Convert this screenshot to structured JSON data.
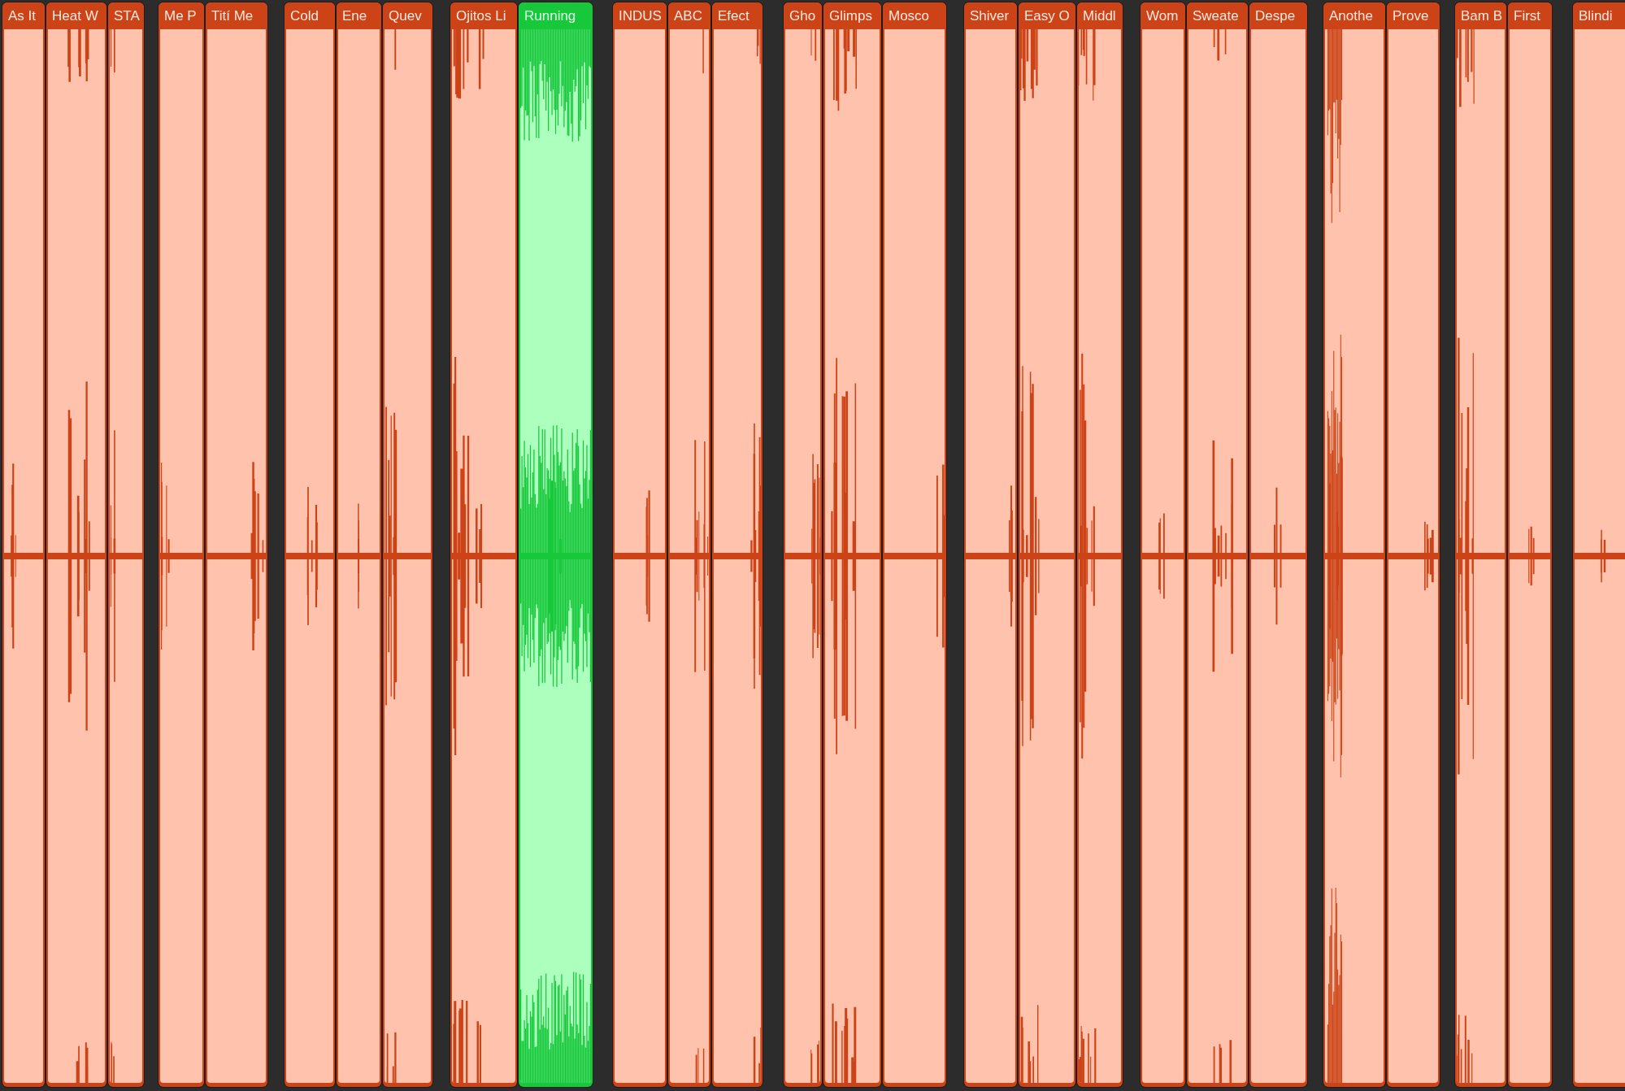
{
  "arrangement": {
    "region_groups": [
      {
        "regions": [
          {
            "title": "As It",
            "color": "#cb4316"
          },
          {
            "title": "Heat W",
            "color": "#cb4316"
          },
          {
            "title": "STA",
            "color": "#cb4316"
          }
        ]
      },
      {
        "regions": [
          {
            "title": "Me P",
            "color": "#cb4316"
          },
          {
            "title": "Tití Me",
            "color": "#cb4316"
          }
        ]
      },
      {
        "regions": [
          {
            "title": "Cold",
            "color": "#cb4316"
          },
          {
            "title": "Ene",
            "color": "#cb4316"
          },
          {
            "title": "Quev",
            "color": "#cb4316"
          }
        ]
      },
      {
        "regions": [
          {
            "title": "Ojitos Li",
            "color": "#cb4316"
          },
          {
            "title": "Running",
            "color": "#17c83b"
          }
        ]
      },
      {
        "regions": [
          {
            "title": "INDUS",
            "color": "#cb4316"
          },
          {
            "title": "ABC",
            "color": "#cb4316"
          },
          {
            "title": "Efect",
            "color": "#cb4316"
          }
        ]
      },
      {
        "regions": [
          {
            "title": "Gho",
            "color": "#cb4316"
          },
          {
            "title": "Glimps",
            "color": "#cb4316"
          },
          {
            "title": "Mosco",
            "color": "#cb4316"
          }
        ]
      },
      {
        "regions": [
          {
            "title": "Shiver",
            "color": "#cb4316"
          },
          {
            "title": "Easy O",
            "color": "#cb4316"
          },
          {
            "title": "Middl",
            "color": "#cb4316"
          }
        ]
      },
      {
        "regions": [
          {
            "title": "Wom",
            "color": "#cb4316"
          },
          {
            "title": "Sweate",
            "color": "#cb4316"
          },
          {
            "title": "Despe",
            "color": "#cb4316"
          }
        ]
      },
      {
        "regions": [
          {
            "title": "Anothe",
            "color": "#cb4316"
          },
          {
            "title": "Prove",
            "color": "#cb4316"
          }
        ]
      },
      {
        "regions": [
          {
            "title": "Bam B",
            "color": "#cb4316"
          },
          {
            "title": "First",
            "color": "#cb4316"
          }
        ]
      },
      {
        "regions": [
          {
            "title": "Blindi",
            "color": "#cb4316"
          }
        ]
      }
    ]
  }
}
